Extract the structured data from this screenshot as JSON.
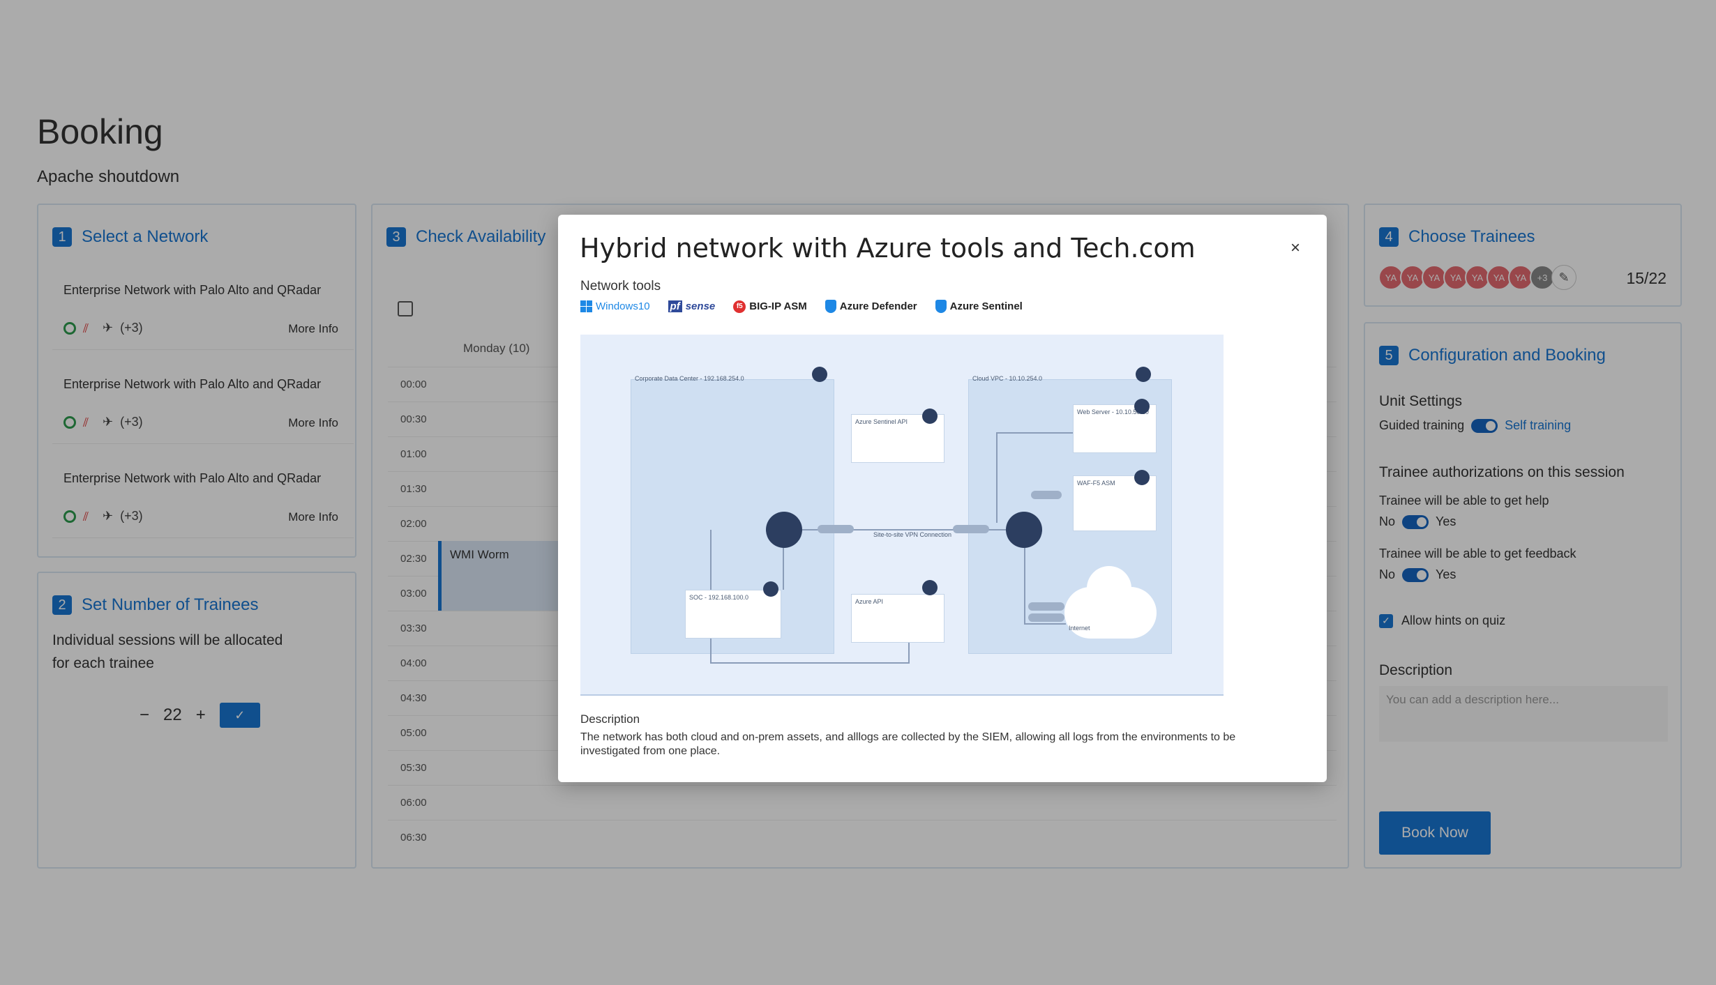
{
  "page": {
    "title": "Booking",
    "subtitle": "Apache shoutdown"
  },
  "step1": {
    "num": "1",
    "title": "Select a Network",
    "networks": [
      {
        "name": "Enterprise Network with Palo Alto and QRadar",
        "extra": "(+3)",
        "more": "More Info"
      },
      {
        "name": "Enterprise Network with Palo Alto and QRadar",
        "extra": "(+3)",
        "more": "More Info"
      },
      {
        "name": "Enterprise Network with Palo Alto and QRadar",
        "extra": "(+3)",
        "more": "More Info"
      }
    ]
  },
  "step2": {
    "num": "2",
    "title": "Set Number of Trainees",
    "text1": "Individual sessions will be allocated",
    "text2": "for each trainee",
    "minus": "−",
    "value": "22",
    "plus": "+",
    "confirm": "✓"
  },
  "step3": {
    "num": "3",
    "title": "Check Availability",
    "day": "Monday (10)",
    "times": [
      "00:00",
      "00:30",
      "01:00",
      "01:30",
      "02:00",
      "02:30",
      "03:00",
      "03:30",
      "04:00",
      "04:30",
      "05:00",
      "05:30",
      "06:00",
      "06:30"
    ],
    "event": "WMI Worm"
  },
  "step4": {
    "num": "4",
    "title": "Choose Trainees",
    "avatars": [
      "YA",
      "YA",
      "YA",
      "YA",
      "YA",
      "YA",
      "YA"
    ],
    "more": "+3",
    "count": "15/22"
  },
  "step5": {
    "num": "5",
    "title": "Configuration and Booking",
    "unit_settings": "Unit Settings",
    "guided": "Guided training",
    "self": "Self training",
    "auth_title": "Trainee authorizations on this session",
    "help_label": "Trainee will be able to get help",
    "feedback_label": "Trainee will be able to get feedback",
    "no": "No",
    "yes": "Yes",
    "hints": "Allow hints on quiz",
    "desc_label": "Description",
    "desc_placeholder": "You can add a description here...",
    "book": "Book Now"
  },
  "modal": {
    "title": "Hybrid network with Azure tools and Tech.com",
    "close": "×",
    "tools_label": "Network tools",
    "tools": [
      {
        "name": "Windows10",
        "icon": "windows-icon"
      },
      {
        "name": "sense",
        "prefix": "pf",
        "icon": "pfsense-logo"
      },
      {
        "name": "BIG-IP ASM",
        "icon": "f5-icon"
      },
      {
        "name": "Azure Defender",
        "icon": "shield-icon"
      },
      {
        "name": "Azure Sentinel",
        "icon": "shield-icon"
      }
    ],
    "desc_label": "Description",
    "desc_text": "The network has both cloud and on-prem assets, and alllogs are collected by the SIEM, allowing all logs from the environments to be investigated from one place.",
    "diagram": {
      "onprem_label": "Corporate Data Center - 192.168.254.0",
      "cloud_label": "Cloud VPC - 10.10.254.0",
      "azure_sentinel_api": "Azure Sentinel API",
      "azure_api": "Azure API",
      "soc_label": "SOC - 192.168.100.0",
      "web_server": "Web Server - 10.10.50.10",
      "waf_label": "WAF-F5 ASM",
      "vpn_label": "Site-to-site VPN Connection",
      "internet": "Internet"
    }
  },
  "colors": {
    "accent": "#1976d2",
    "avatar": "#e46b70"
  }
}
